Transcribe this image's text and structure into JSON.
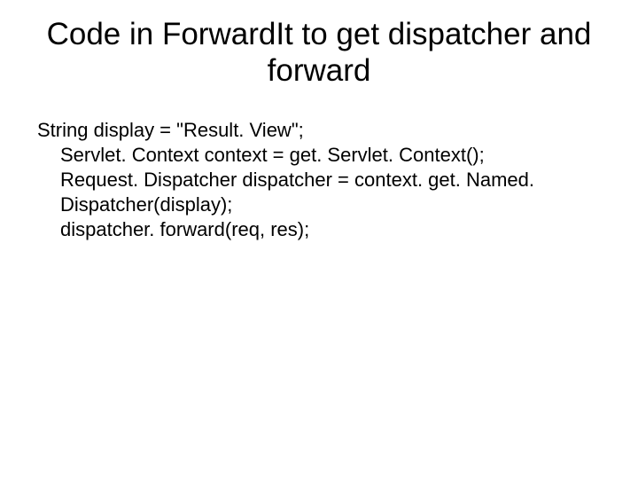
{
  "title": "Code in ForwardIt to get dispatcher and forward",
  "code": {
    "l1": "String display = \"Result. View\";",
    "l2": "Servlet. Context context = get. Servlet. Context();",
    "l3": "Request. Dispatcher dispatcher = context. get. Named. Dispatcher(display);",
    "l4": "dispatcher. forward(req, res);"
  }
}
